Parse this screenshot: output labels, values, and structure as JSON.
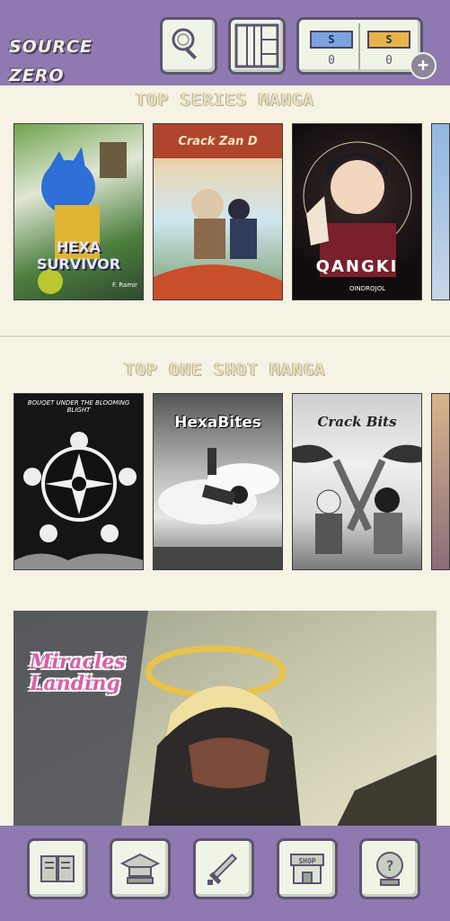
{
  "header": {
    "logo_text": "SOURCE ZERO",
    "currency": [
      {
        "ticket_label": "S",
        "count": "0",
        "color": "#7aa3e0"
      },
      {
        "ticket_label": "S",
        "count": "0",
        "color": "#e7b547"
      }
    ]
  },
  "sections": [
    {
      "title": "TOP SERIES MANGA",
      "items": [
        {
          "title": "HEXA SURVIVOR",
          "author": "F. Ramir"
        },
        {
          "title": "Crack Zan D"
        },
        {
          "title": "QANGKI",
          "author": "OINDROJOL"
        }
      ]
    },
    {
      "title": "TOP ONE SHOT MANGA",
      "items": [
        {
          "title": "BOUQET UNDER THE BLOOMING BLIGHT"
        },
        {
          "title": "HexaBites"
        },
        {
          "title": "Crack Bits"
        }
      ]
    }
  ],
  "banner": {
    "title": "Miracles Landing"
  },
  "bottom_nav": [
    {
      "icon": "book-icon"
    },
    {
      "icon": "graduation-cap-icon"
    },
    {
      "icon": "sword-icon"
    },
    {
      "icon": "shop-icon",
      "label": "SHOP"
    },
    {
      "icon": "help-icon",
      "label": "?"
    }
  ],
  "colors": {
    "bar": "#8f79b1",
    "background": "#f6f2e4"
  }
}
